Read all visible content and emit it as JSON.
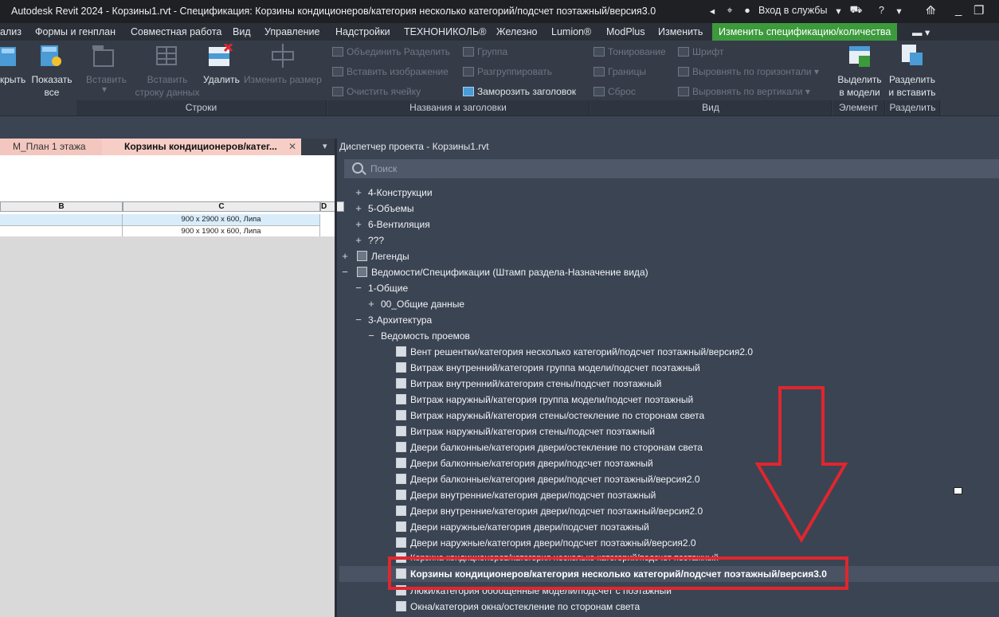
{
  "titlebar": {
    "title": "Autodesk Revit 2024 - Корзины1.rvt - Спецификация: Корзины кондиционеров/категория несколько категорий/подсчет поэтажный/версия3.0",
    "signin": "Вход в службы",
    "help_icon": "help-icon"
  },
  "menu": {
    "items": [
      "ализ",
      "Формы и генплан",
      "Совместная работа",
      "Вид",
      "Управление",
      "Надстройки",
      "ТЕХНОНИКОЛЬ®",
      "Железно",
      "Lumion®",
      "ModPlus",
      "Изменить",
      "Изменить спецификацию/количества"
    ],
    "active_index": 11
  },
  "ribbon": {
    "rows_group": {
      "label": "Строки",
      "hide": "крыть",
      "show_all_1": "Показать",
      "show_all_2": "все",
      "insert": "Вставить",
      "insert_row_1": "Вставить",
      "insert_row_2": "строку данных",
      "delete": "Удалить",
      "resize": "Изменить размер"
    },
    "titles_group": {
      "label": "Названия и заголовки",
      "merge": "Объединить",
      "split": "Разделить",
      "group": "Группа",
      "insert_image": "Вставить изображение",
      "ungroup": "Разгруппировать",
      "clear_cell": "Очистить ячейку",
      "freeze": "Заморозить заголовок"
    },
    "view_group": {
      "label": "Вид",
      "shading": "Тонирование",
      "font": "Шрифт",
      "borders": "Границы",
      "align_h": "Выровнять по горизонтали",
      "reset": "Сброс",
      "align_v": "Выровнять по вертикали"
    },
    "element_group": {
      "label": "Элемент",
      "select_1": "Выделить",
      "select_2": "в модели"
    },
    "split_group": {
      "label": "Разделить",
      "split_1": "Разделить",
      "split_2": "и вставить"
    }
  },
  "tabs": [
    {
      "label": "М_План 1 этажа"
    },
    {
      "label": "Корзины кондиционеров/катег..."
    }
  ],
  "schedule": {
    "columns": [
      "B",
      "C",
      "D"
    ],
    "rows": [
      {
        "c": "900 х 2900 х 600, Липа"
      },
      {
        "c": "900 х 1900 х 600, Липа"
      }
    ]
  },
  "project_browser": {
    "title": "Диспетчер проекта - Корзины1.rvt",
    "search_placeholder": "Поиск",
    "tree": [
      {
        "label": "4-Конструкции",
        "state": "+"
      },
      {
        "label": "5-Объемы",
        "state": "+"
      },
      {
        "label": "6-Вентиляция",
        "state": "+"
      },
      {
        "label": "???",
        "state": "+"
      },
      {
        "label": "Легенды",
        "state": "+"
      },
      {
        "label": "Ведомости/Спецификации (Штамп раздела-Назначение вида)",
        "state": "−"
      },
      {
        "label": "1-Общие",
        "state": "−"
      },
      {
        "label": "00_Общие данные",
        "state": "+"
      },
      {
        "label": "3-Архитектура",
        "state": "−"
      },
      {
        "label": "Ведомость проемов",
        "state": "−"
      },
      {
        "label": "Вент решентки/категория несколько категорий/подсчет поэтажный/версия2.0"
      },
      {
        "label": "Витраж внутренний/категория группа модели/подсчет поэтажный"
      },
      {
        "label": "Витраж внутренний/категория стены/подсчет поэтажный"
      },
      {
        "label": "Витраж наружный/категория группа модели/подсчет поэтажный"
      },
      {
        "label": "Витраж наружный/категория стены/остекление по сторонам света"
      },
      {
        "label": "Витраж наружный/категория стены/подсчет поэтажный"
      },
      {
        "label": "Двери балконные/категория двери/остекление по сторонам света"
      },
      {
        "label": "Двери балконные/категория двери/подсчет поэтажный"
      },
      {
        "label": "Двери балконные/категория двери/подсчет поэтажный/версия2.0"
      },
      {
        "label": "Двери внутренние/категория двери/подсчет поэтажный"
      },
      {
        "label": "Двери внутренние/категория двери/подсчет поэтажный/версия2.0"
      },
      {
        "label": "Двери наружные/категория двери/подсчет поэтажный"
      },
      {
        "label": "Двери наружные/категория двери/подсчет поэтажный/версия2.0"
      },
      {
        "label": "Корзина кондиционеров/категория несколько категорий/подсчет поэтажный"
      },
      {
        "label": "Корзины кондиционеров/категория несколько категорий/подсчет поэтажный/версия3.0",
        "selected": true
      },
      {
        "label": "Люки/категория обобщенные модели/подсчет с поэтажный"
      },
      {
        "label": "Окна/категория окна/остекление по сторонам света"
      }
    ]
  },
  "annotation": {
    "highlight_color": "#e0262e"
  }
}
